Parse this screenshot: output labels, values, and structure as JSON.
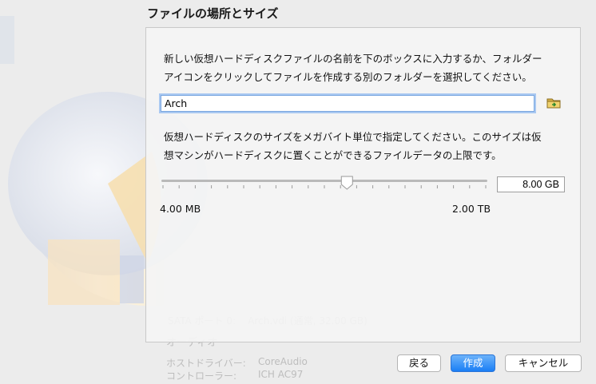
{
  "dialog": {
    "title": "ファイルの場所とサイズ",
    "location_description_line1": "新しい仮想ハードディスクファイルの名前を下のボックスに入力するか、フォルダー",
    "location_description_line2": "アイコンをクリックしてファイルを作成する別のフォルダーを選択してください。",
    "file_name_value": "Arch",
    "size_description_line1": "仮想ハードディスクのサイズをメガバイト単位で指定してください。このサイズは仮",
    "size_description_line2": "想マシンがハードディスクに置くことができるファイルデータの上限です。",
    "size_value": "8.00 GB",
    "size_slider_fraction": 0.57,
    "range_min": "4.00 MB",
    "range_max": "2.00 TB"
  },
  "buttons": {
    "back": "戻る",
    "create": "作成",
    "cancel": "キャンセル"
  },
  "background": {
    "audio_section": "オーディオ",
    "host_driver_label": "ホストドライバー:",
    "host_driver_value": "CoreAudio",
    "controller_label": "コントローラー:",
    "controller_value": "ICH AC97"
  },
  "colors": {
    "accent": "#1a7ef5",
    "focus_ring": "#a9c8f1"
  }
}
